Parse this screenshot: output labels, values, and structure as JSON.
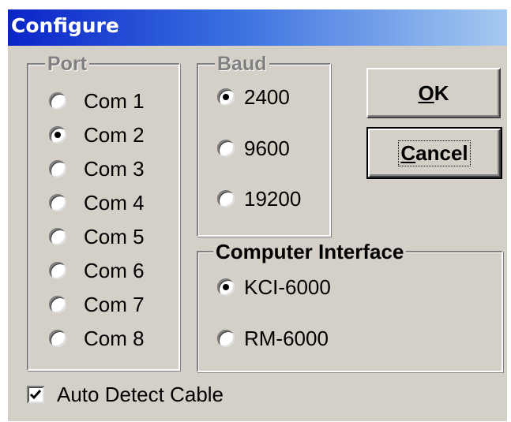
{
  "window": {
    "title": "Configure"
  },
  "port": {
    "legend": "Port",
    "options": [
      {
        "label": "Com 1",
        "checked": false
      },
      {
        "label": "Com 2",
        "checked": true
      },
      {
        "label": "Com 3",
        "checked": false
      },
      {
        "label": "Com 4",
        "checked": false
      },
      {
        "label": "Com 5",
        "checked": false
      },
      {
        "label": "Com 6",
        "checked": false
      },
      {
        "label": "Com 7",
        "checked": false
      },
      {
        "label": "Com 8",
        "checked": false
      }
    ]
  },
  "baud": {
    "legend": "Baud",
    "options": [
      {
        "label": "2400",
        "checked": true
      },
      {
        "label": "9600",
        "checked": false
      },
      {
        "label": "19200",
        "checked": false
      }
    ]
  },
  "interface": {
    "legend": "Computer Interface",
    "options": [
      {
        "label": "KCI-6000",
        "checked": true
      },
      {
        "label": "RM-6000",
        "checked": false
      }
    ]
  },
  "buttons": {
    "ok_label": "OK",
    "ok_mnemonic": "O",
    "ok_rest": "K",
    "cancel_label": "Cancel",
    "cancel_mnemonic": "C",
    "cancel_rest": "ancel"
  },
  "auto_detect": {
    "label": "Auto Detect Cable",
    "checked": true
  },
  "colors": {
    "face": "#d4d0c8",
    "title_start": "#0a24c8",
    "title_end": "#a6caf0",
    "disabled_text": "#808080"
  }
}
